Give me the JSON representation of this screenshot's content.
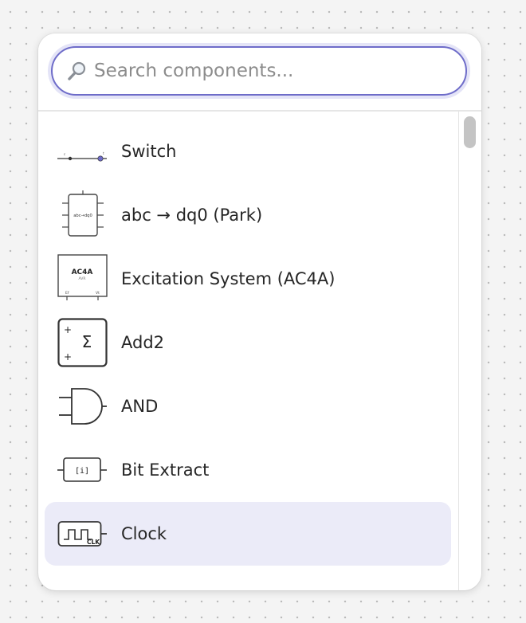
{
  "search": {
    "placeholder": "Search components...",
    "value": ""
  },
  "items": [
    {
      "label": "Switch",
      "icon": "switch-icon"
    },
    {
      "label": "abc → dq0 (Park)",
      "icon": "park-transform-icon",
      "icon_text": "abc→dq0"
    },
    {
      "label": "Excitation System (AC4A)",
      "icon": "excitation-system-icon",
      "icon_text": "AC4A",
      "icon_subtext": "AVR",
      "icon_port_left": "Ef",
      "icon_port_right": "Vt"
    },
    {
      "label": "Add2",
      "icon": "sum-icon",
      "icon_text": "Σ"
    },
    {
      "label": "AND",
      "icon": "and-gate-icon"
    },
    {
      "label": "Bit Extract",
      "icon": "bit-extract-icon",
      "icon_text": "[i]"
    },
    {
      "label": "Clock",
      "icon": "clock-icon",
      "icon_text": "CLK"
    }
  ],
  "selected_index": 6,
  "colors": {
    "accent": "#6e6cc9",
    "selected_bg": "#ebebf8"
  }
}
